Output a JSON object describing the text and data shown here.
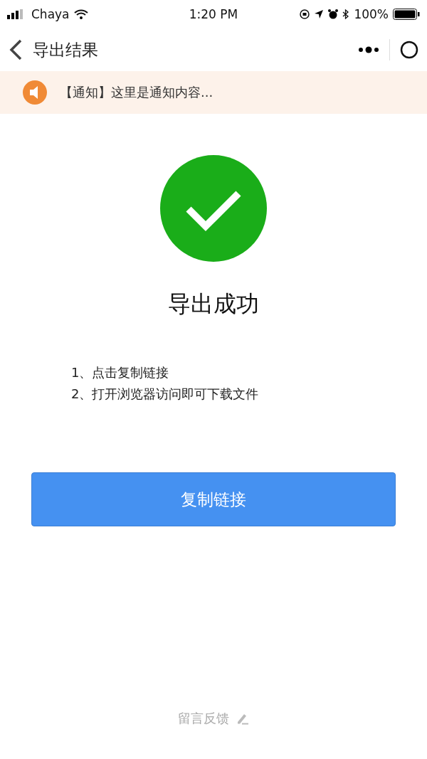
{
  "status_bar": {
    "carrier": "Chaya",
    "time": "1:20 PM",
    "battery": "100%"
  },
  "nav": {
    "title": "导出结果"
  },
  "notice": {
    "text": "【通知】这里是通知内容..."
  },
  "result": {
    "success": true,
    "title": "导出成功"
  },
  "steps": [
    "1、点击复制链接",
    "2、打开浏览器访问即可下载文件"
  ],
  "button": {
    "label": "复制链接"
  },
  "footer": {
    "label": "留言反馈"
  }
}
